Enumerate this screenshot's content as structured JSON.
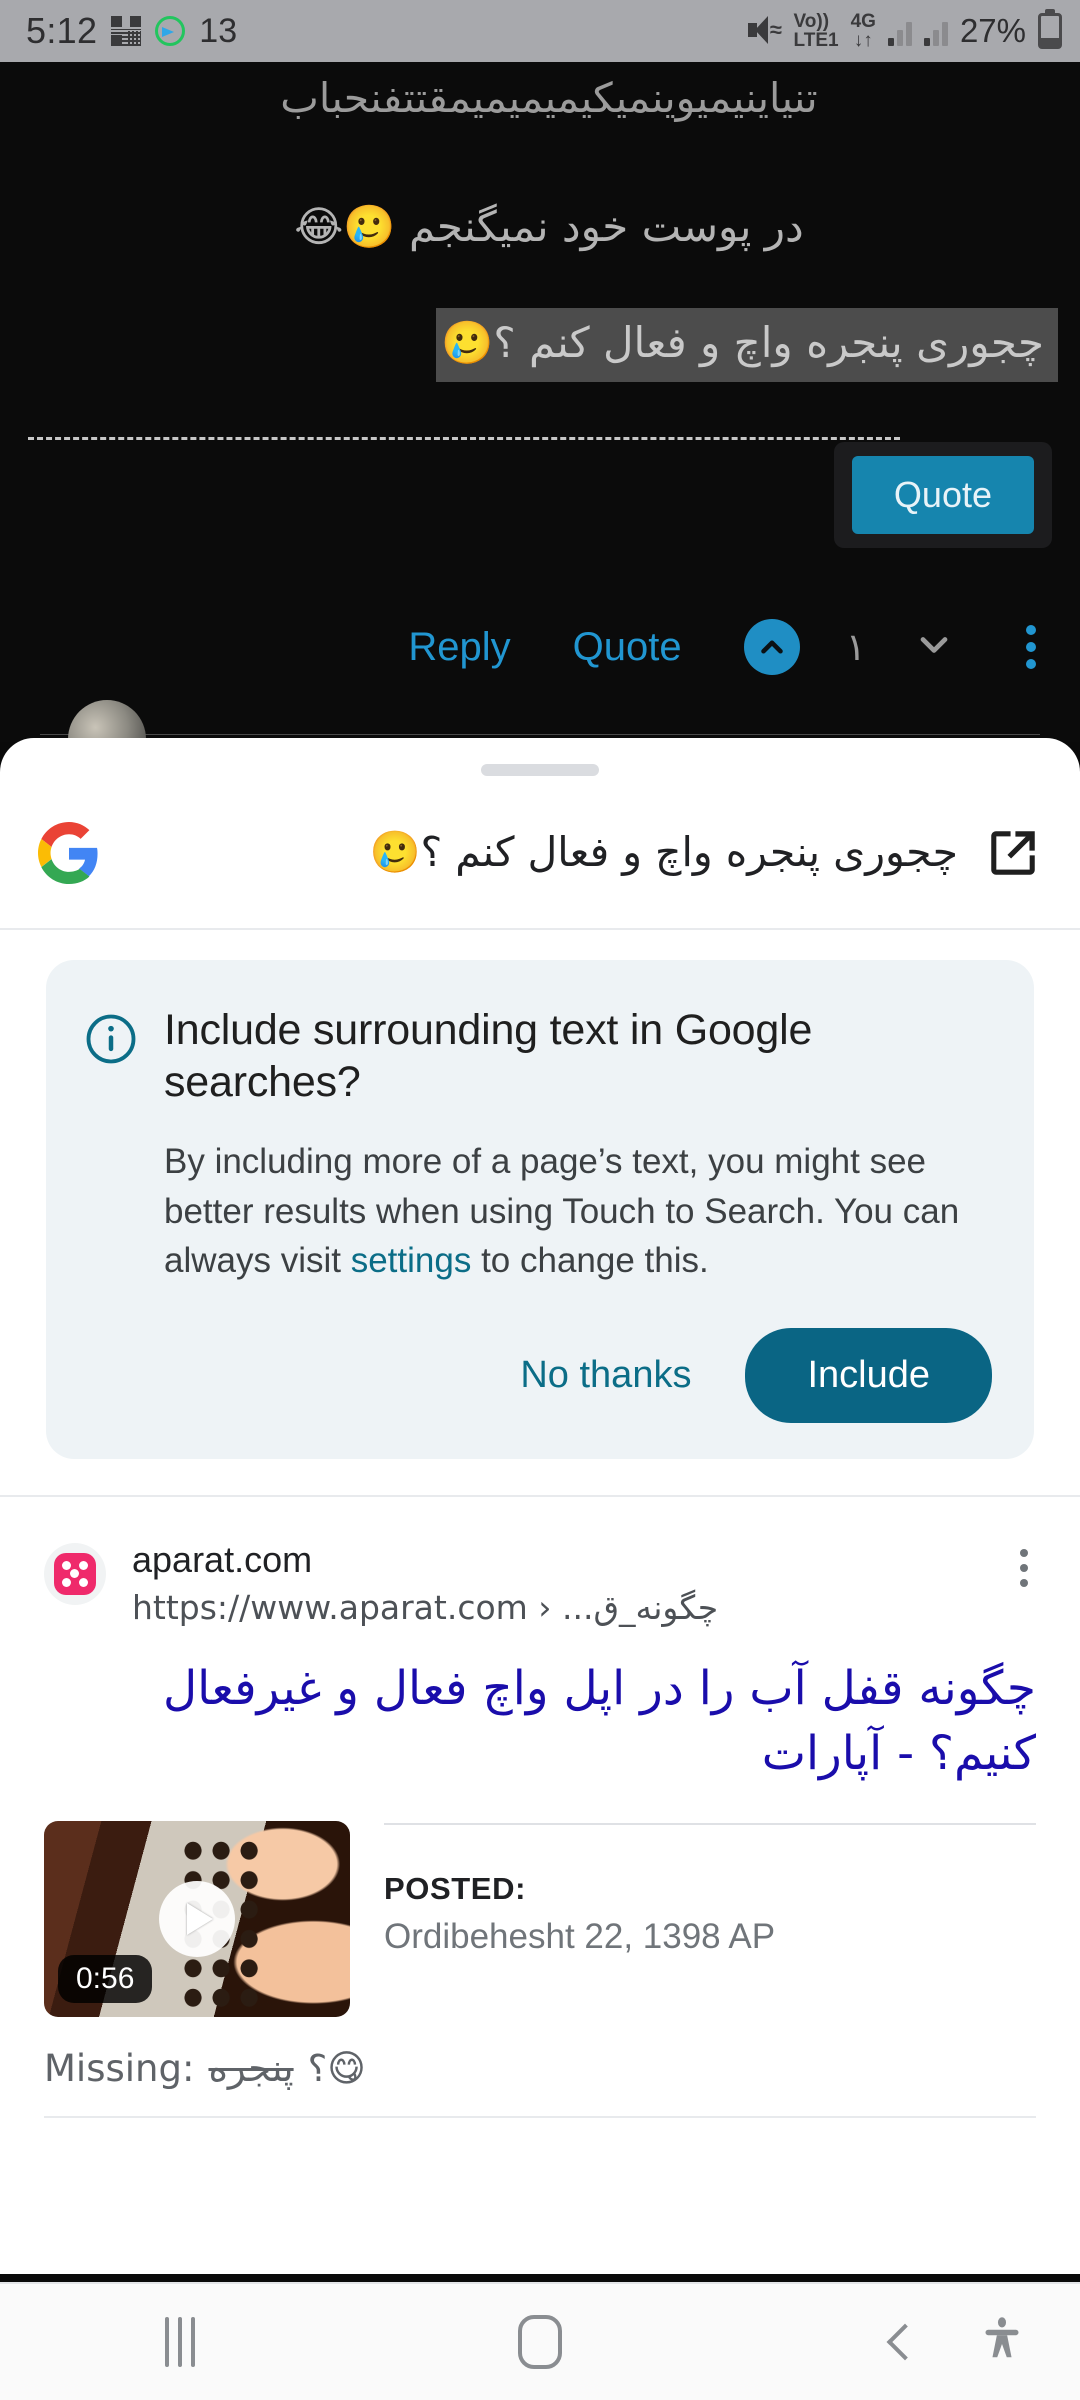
{
  "status_bar": {
    "time": "5:12",
    "notification_count": "13",
    "icons": [
      "qr-scanner-icon",
      "green-circle-arrow-icon",
      "mute-icon",
      "volte-icon",
      "4g-data-icon",
      "signal-bars-icon",
      "signal-bars-2-icon"
    ],
    "volte_top": "Vo))",
    "volte_bottom": "LTE1",
    "network_top": "4G",
    "network_bottom": "↓↑",
    "battery_percent": "27%"
  },
  "forum": {
    "line1": "تنیاینیمیوینمیکیمیمیمیمقتتفنحباب",
    "line2": "در پوست خود نمیگنجم 🥲😂",
    "selected_text": "چجوری پنجره واچ و فعال کنم ؟🥲",
    "quote_popup_label": "Quote",
    "reply_label": "Reply",
    "quote_label": "Quote",
    "vote_count": "۱"
  },
  "panel": {
    "query": "چجوری پنجره واچ و فعال کنم ؟🥲",
    "logo": "google-g-logo",
    "open_in_new": "open-in-new-icon"
  },
  "info_card": {
    "icon": "info-icon",
    "title": "Include surrounding text in Google searches?",
    "description_before": "By including more of a page’s text, you might see better results when using Touch to Search. You can always visit ",
    "link": "settings",
    "description_after": " to change this.",
    "decline_label": "No thanks",
    "accept_label": "Include"
  },
  "result": {
    "favicon": "aparat-favicon",
    "domain": "aparat.com",
    "url": "https://www.aparat.com › ...چگونه_ق",
    "overflow_menu": "more-options-icon",
    "title": "چگونه قفل آب را در اپل واچ فعال و غیرفعال کنیم؟ - آپارات",
    "video_duration": "0:56",
    "posted_label": "POSTED:",
    "posted_value": "Ordibehesht 22, 1398 AP",
    "missing_label": "Missing:",
    "missing_term": "پنجره",
    "missing_extra": "؟😋"
  },
  "navbar": {
    "recents": "recents-icon",
    "home": "home-icon",
    "back": "back-icon",
    "accessibility": "accessibility-icon"
  },
  "colors": {
    "accent_teal": "#0a6584",
    "link_blue": "#1a0dab",
    "forum_blue": "#2196d1",
    "quote_blue": "#1685ae",
    "card_bg": "#eef3f6"
  }
}
